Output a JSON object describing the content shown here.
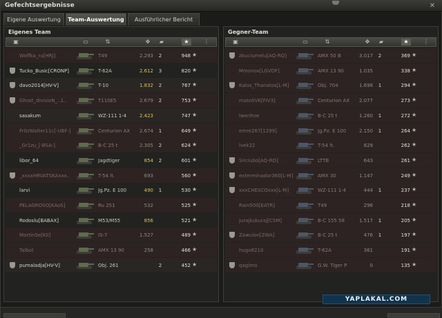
{
  "window": {
    "title": "Gefechtsergebnisse",
    "close_glyph": "✕"
  },
  "tabs": [
    {
      "label": "Eigene Auswertung",
      "active": false
    },
    {
      "label": "Team-Auswertung",
      "active": true
    },
    {
      "label": "Ausführlicher Bericht",
      "active": false
    }
  ],
  "own_team": {
    "title": "Eigenes Team",
    "headers": [
      "▣",
      "▭",
      "⇅",
      "✥",
      "▰",
      "★",
      "⋮"
    ],
    "rows": [
      {
        "name": "Woffka_ru[HRJ]",
        "tank": "T49",
        "damage": "2.293",
        "kills": "2",
        "xp": "948",
        "state": "dead",
        "dmg_hi": false,
        "clan": false
      },
      {
        "name": "Tucko_Busic[CRONP]",
        "tank": "T-62A",
        "damage": "2.612",
        "kills": "3",
        "xp": "820",
        "state": "alive",
        "dmg_hi": true,
        "clan": true
      },
      {
        "name": "davo2014[HV-V]",
        "tank": "T-10",
        "damage": "1.832",
        "kills": "2",
        "xp": "767",
        "state": "alive",
        "dmg_hi": true,
        "clan": true
      },
      {
        "name": "Ghost_divisioN_..1..",
        "tank": "T110E5",
        "damage": "2.679",
        "kills": "2",
        "xp": "753",
        "state": "dead",
        "dmg_hi": false,
        "clan": true
      },
      {
        "name": "sasakum",
        "tank": "WZ-111 1-4",
        "damage": "2.423",
        "kills": "",
        "xp": "747",
        "state": "alive",
        "dmg_hi": true,
        "clan": false
      },
      {
        "name": "FritzWalter11c[-UBF-]",
        "tank": "Centurion AX",
        "damage": "2.674",
        "kills": "1",
        "xp": "649",
        "state": "dead",
        "dmg_hi": false,
        "clan": false
      },
      {
        "name": "_Gr1zu_[-BSA-]",
        "tank": "B-C 25 t",
        "damage": "2.305",
        "kills": "2",
        "xp": "624",
        "state": "dead",
        "dmg_hi": false,
        "clan": false
      },
      {
        "name": "libor_64",
        "tank": "Jagdtiger",
        "damage": "854",
        "kills": "2",
        "xp": "601",
        "state": "alive",
        "dmg_hi": true,
        "clan": false
      },
      {
        "name": "_xxxxHRVATSKAxxx..",
        "tank": "T-54 lt.",
        "damage": "693",
        "kills": "",
        "xp": "560",
        "state": "dead",
        "dmg_hi": false,
        "clan": true
      },
      {
        "name": "larvi",
        "tank": "Jg.Pz. E 100",
        "damage": "490",
        "kills": "1",
        "xp": "530",
        "state": "alive",
        "dmg_hi": true,
        "clan": false
      },
      {
        "name": "PELAGROSO[KAoS]",
        "tank": "Ru 251",
        "damage": "532",
        "kills": "",
        "xp": "525",
        "state": "dead",
        "dmg_hi": false,
        "clan": false
      },
      {
        "name": "Rodoslu[BABAX]",
        "tank": "M53/M55",
        "damage": "856",
        "kills": "",
        "xp": "521",
        "state": "alive",
        "dmg_hi": true,
        "clan": false
      },
      {
        "name": "MartinSe[KII]",
        "tank": "IS-7",
        "damage": "1.527",
        "kills": "",
        "xp": "489",
        "state": "dead",
        "dmg_hi": false,
        "clan": false
      },
      {
        "name": "Talbot",
        "tank": "AMX 13 90",
        "damage": "258",
        "kills": "",
        "xp": "466",
        "state": "dead",
        "dmg_hi": false,
        "clan": false
      },
      {
        "name": "pumaladja[HV-V]",
        "tank": "Obj. 261",
        "damage": "",
        "kills": "2",
        "xp": "452",
        "state": "alive",
        "dmg_hi": false,
        "clan": true
      }
    ]
  },
  "enemy_team": {
    "title": "Gegner-Team",
    "headers": [
      "▣",
      "▭",
      "⇅",
      "✥",
      "▰",
      "★",
      "⋮"
    ],
    "rows": [
      {
        "name": "zbuciumelu[AQ-RO]",
        "tank": "AMX 50 B",
        "damage": "3.017",
        "kills": "2",
        "xp": "369",
        "state": "dead",
        "dmg_hi": false,
        "clan": true
      },
      {
        "name": "Mmonox[LGVDF]",
        "tank": "AMX 13 90",
        "damage": "1.035",
        "kills": "",
        "xp": "338",
        "state": "dead",
        "dmg_hi": false,
        "clan": false
      },
      {
        "name": "Kalos_Thanatos[L-M]",
        "tank": "Obj. 704",
        "damage": "1.698",
        "kills": "1",
        "xp": "294",
        "state": "dead",
        "dmg_hi": false,
        "clan": true
      },
      {
        "name": "matoSVK[FIV3]",
        "tank": "Centurion AX",
        "damage": "2.077",
        "kills": "",
        "xp": "273",
        "state": "dead",
        "dmg_hi": false,
        "clan": false
      },
      {
        "name": "lwenhoe",
        "tank": "B-C 25 t",
        "damage": "1.260",
        "kills": "1",
        "xp": "272",
        "state": "dead",
        "dmg_hi": false,
        "clan": false
      },
      {
        "name": "emre267[1299]",
        "tank": "Jg.Pz. E 100",
        "damage": "2.150",
        "kills": "1",
        "xp": "264",
        "state": "dead",
        "dmg_hi": false,
        "clan": false
      },
      {
        "name": "lvek22",
        "tank": "T-54 lt.",
        "damage": "829",
        "kills": "",
        "xp": "262",
        "state": "dead",
        "dmg_hi": false,
        "clan": false
      },
      {
        "name": "Sirciubo[AQ-RO]",
        "tank": "LTTB",
        "damage": "643",
        "kills": "",
        "xp": "261",
        "state": "dead",
        "dmg_hi": false,
        "clan": true
      },
      {
        "name": "exterminador360[L-M]",
        "tank": "AMX 30",
        "damage": "1.147",
        "kills": "",
        "xp": "249",
        "state": "dead",
        "dmg_hi": false,
        "clan": true
      },
      {
        "name": "xxxCHESCOxxx[L-M]",
        "tank": "WZ-111 1-4",
        "damage": "444",
        "kills": "1",
        "xp": "237",
        "state": "dead",
        "dmg_hi": false,
        "clan": true
      },
      {
        "name": "Rain500[EATR]",
        "tank": "T49",
        "damage": "296",
        "kills": "",
        "xp": "218",
        "state": "dead",
        "dmg_hi": false,
        "clan": false
      },
      {
        "name": "jurajkukuraj[CSM]",
        "tank": "B-C 155 58",
        "damage": "1.517",
        "kills": "1",
        "xp": "205",
        "state": "dead",
        "dmg_hi": false,
        "clan": false
      },
      {
        "name": "Zawulon[ZWA]",
        "tank": "B-C 25 t",
        "damage": "476",
        "kills": "1",
        "xp": "197",
        "state": "dead",
        "dmg_hi": false,
        "clan": true
      },
      {
        "name": "hugo8210",
        "tank": "T-62A",
        "damage": "361",
        "kills": "",
        "xp": "191",
        "state": "dead",
        "dmg_hi": false,
        "clan": false
      },
      {
        "name": "qagimo",
        "tank": "G.W. Tiger P",
        "damage": "0",
        "kills": "",
        "xp": "135",
        "state": "dead",
        "dmg_hi": false,
        "clan": true
      }
    ]
  },
  "star_glyph": "★",
  "colors": {
    "dead_row": "#2d2322",
    "damage_highlight": "#d7c35a",
    "watermark_bg": "#11344d"
  },
  "watermark": {
    "text": "YAPLAKAL.COM"
  }
}
